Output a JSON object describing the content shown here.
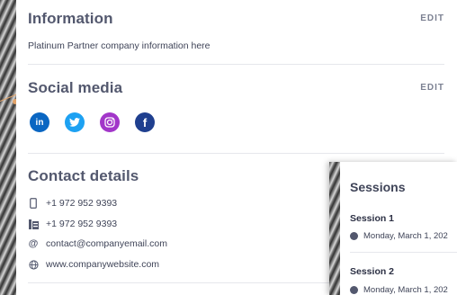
{
  "information": {
    "title": "Information",
    "edit_label": "EDIT",
    "text": "Platinum Partner company information here"
  },
  "social": {
    "title": "Social media",
    "edit_label": "EDIT",
    "icons": [
      {
        "name": "linkedin-icon",
        "glyph": "in",
        "color": "#0a66c2"
      },
      {
        "name": "twitter-icon",
        "glyph": "t",
        "color": "#1da1f2"
      },
      {
        "name": "instagram-icon",
        "glyph": "◎",
        "color": "#a236c9"
      },
      {
        "name": "facebook-icon",
        "glyph": "f",
        "color": "#1f3f8f"
      }
    ]
  },
  "contact": {
    "title": "Contact details",
    "phone": "+1 972 952 9393",
    "fax": "+1 972 952 9393",
    "email": "contact@companyemail.com",
    "website": "www.companywebsite.com"
  },
  "sessions": {
    "title": "Sessions",
    "items": [
      {
        "name": "Session 1",
        "date": "Monday, March 1, 202"
      },
      {
        "name": "Session 2",
        "date": "Monday, March 1, 202"
      }
    ]
  },
  "colors": {
    "title": "#53586e",
    "text": "#3f4458",
    "accent_dot": "#e3a46a"
  }
}
